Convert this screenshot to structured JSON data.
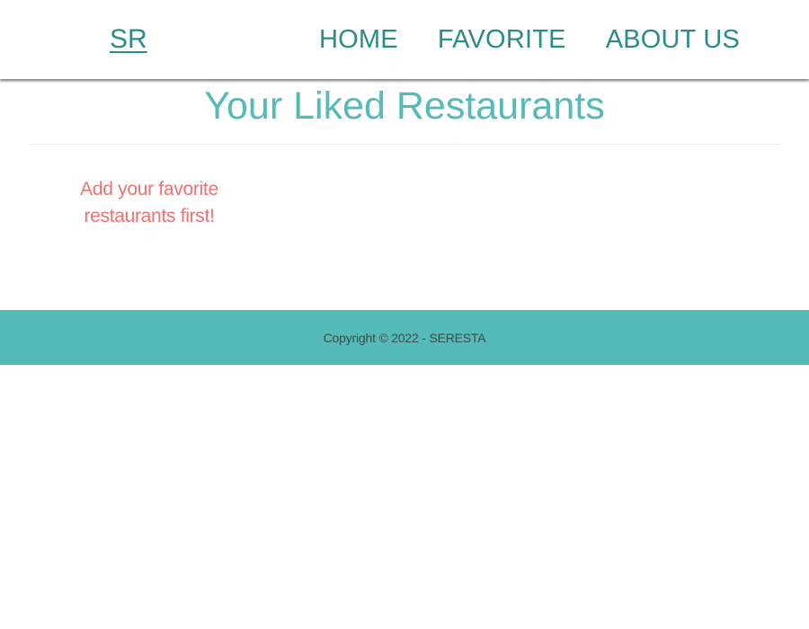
{
  "header": {
    "brand": "SR",
    "nav": [
      {
        "label": "HOME"
      },
      {
        "label": "FAVORITE"
      },
      {
        "label": "ABOUT US"
      }
    ]
  },
  "main": {
    "title": "Your Liked Restaurants",
    "empty_message": "Add your favorite restaurants first!"
  },
  "footer": {
    "copyright": "Copyright © 2022 - SERESTA"
  },
  "colors": {
    "primary": "#2a8c8a",
    "accent": "#55bbb9",
    "empty_state": "#f07070"
  }
}
